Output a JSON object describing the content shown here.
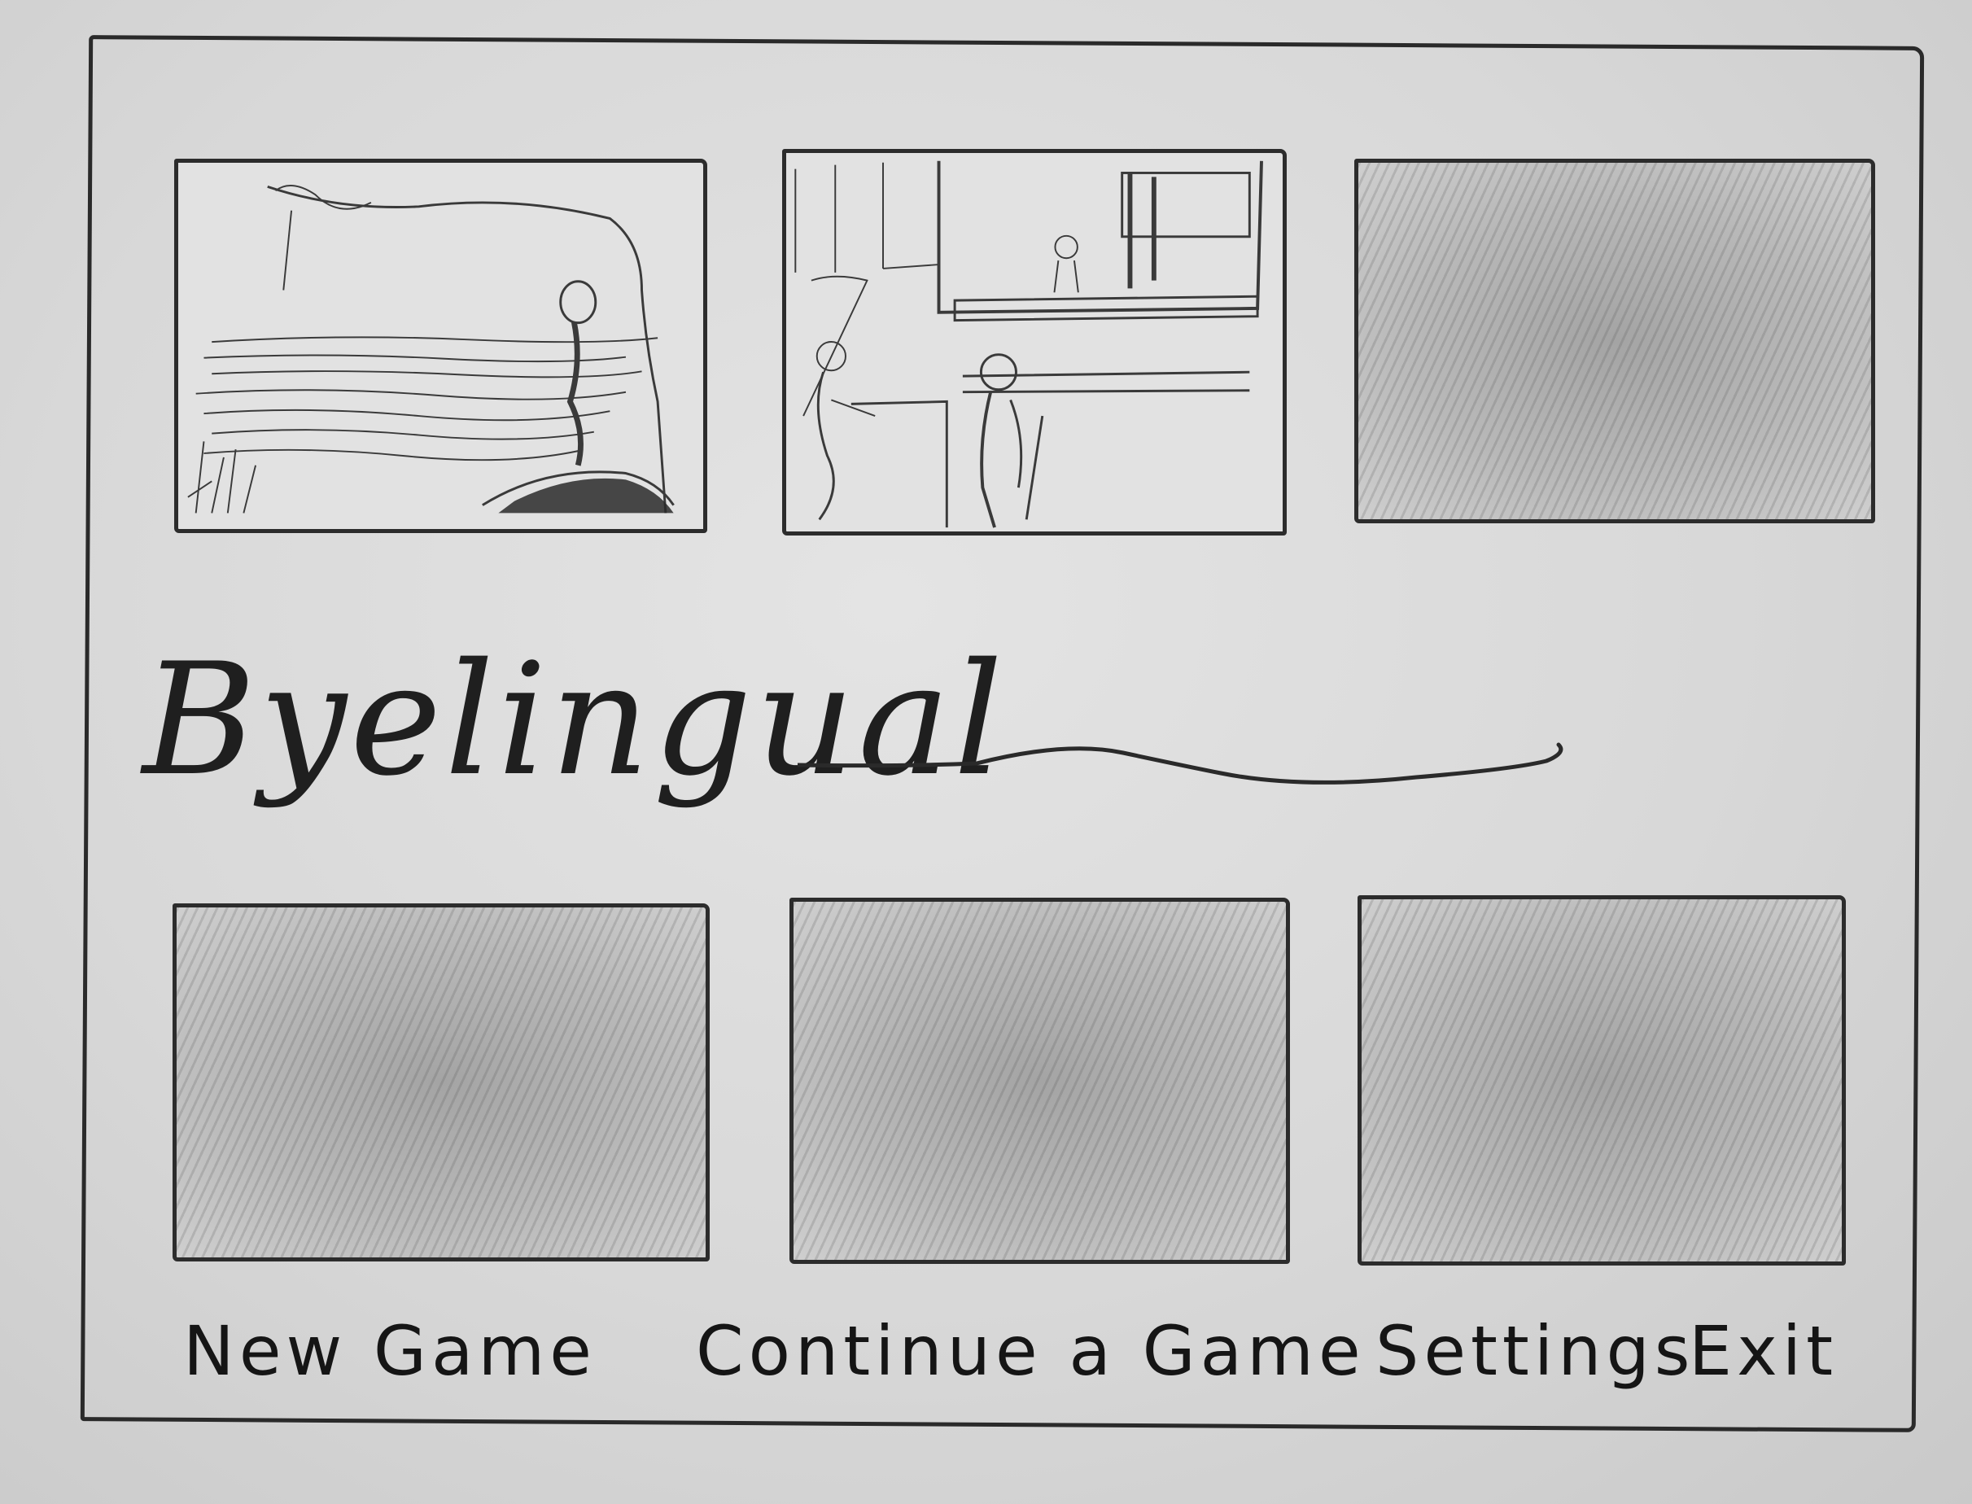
{
  "game": {
    "title": "Byelingual"
  },
  "menu": {
    "new_game": "New Game",
    "continue_game": "Continue a Game",
    "settings": "Settings",
    "exit": "Exit"
  },
  "colors": {
    "paper": "#dcdcdc",
    "pencil": "#2a2a2a",
    "shading": "#a8a8a8"
  }
}
